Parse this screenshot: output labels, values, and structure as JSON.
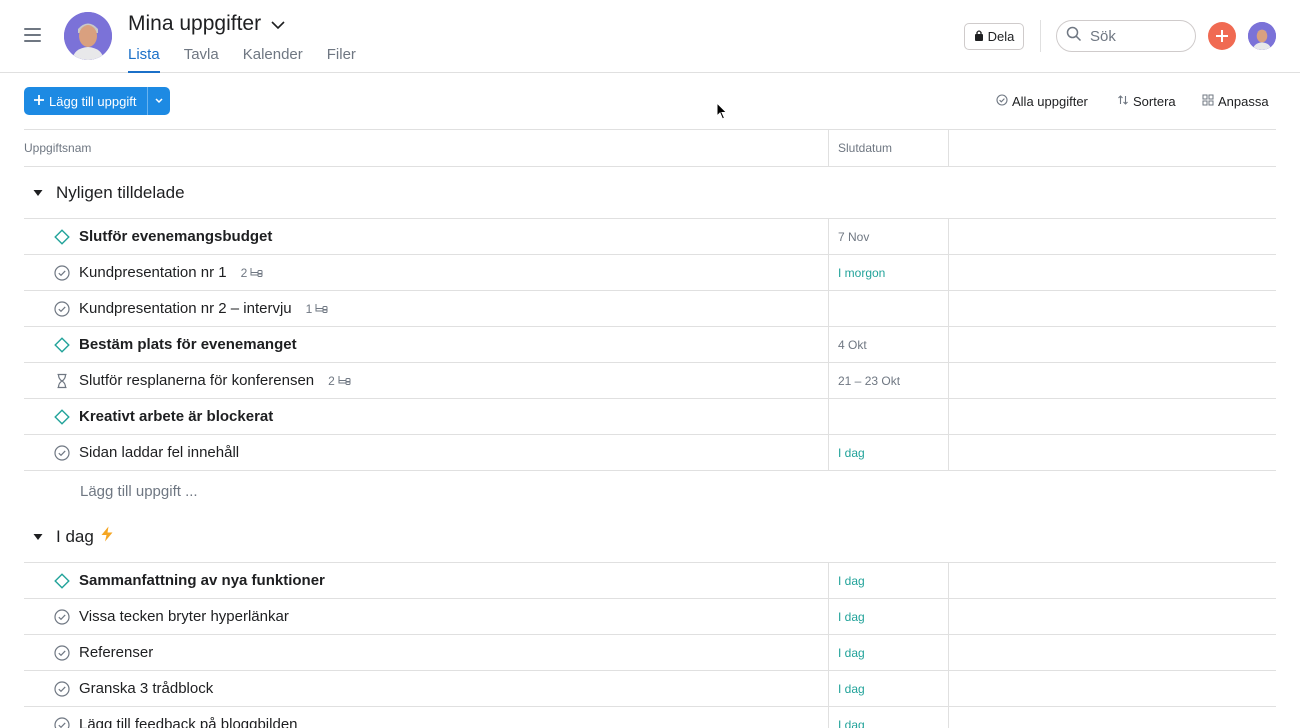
{
  "header": {
    "title": "Mina uppgifter",
    "tabs": [
      {
        "label": "Lista",
        "active": true
      },
      {
        "label": "Tavla",
        "active": false
      },
      {
        "label": "Kalender",
        "active": false
      },
      {
        "label": "Filer",
        "active": false
      }
    ],
    "share_label": "Dela",
    "search_placeholder": "Sök"
  },
  "toolbar": {
    "add_task_label": "Lägg till uppgift",
    "filter_label": "Alla uppgifter",
    "sort_label": "Sortera",
    "customize_label": "Anpassa"
  },
  "table": {
    "col_name": "Uppgiftsnam",
    "col_due": "Slutdatum"
  },
  "sections": [
    {
      "title": "Nyligen tilldelade",
      "emoji": "",
      "tasks": [
        {
          "name": "Slutför evenemangsbudget",
          "bold": true,
          "icon": "milestone-icon",
          "subtasks": "",
          "due": "7 Nov",
          "due_color": "gray"
        },
        {
          "name": "Kundpresentation nr 1",
          "bold": false,
          "icon": "check-circle-icon",
          "subtasks": "2",
          "due": "I morgon",
          "due_color": "green"
        },
        {
          "name": "Kundpresentation nr 2 – intervju",
          "bold": false,
          "icon": "check-circle-icon",
          "subtasks": "1",
          "due": "",
          "due_color": "gray"
        },
        {
          "name": "Bestäm plats för evenemanget",
          "bold": true,
          "icon": "milestone-icon",
          "subtasks": "",
          "due": "4 Okt",
          "due_color": "gray"
        },
        {
          "name": "Slutför resplanerna för konferensen",
          "bold": false,
          "icon": "hourglass-icon",
          "subtasks": "2",
          "due": "21 – 23 Okt",
          "due_color": "gray"
        },
        {
          "name": "Kreativt arbete är blockerat",
          "bold": true,
          "icon": "milestone-icon",
          "subtasks": "",
          "due": "",
          "due_color": "gray"
        },
        {
          "name": "Sidan laddar fel innehåll",
          "bold": false,
          "icon": "check-circle-icon",
          "subtasks": "",
          "due": "I dag",
          "due_color": "green"
        }
      ],
      "add_task_placeholder": "Lägg till uppgift ..."
    },
    {
      "title": "I dag",
      "emoji": "lightning-icon",
      "tasks": [
        {
          "name": "Sammanfattning av nya funktioner",
          "bold": true,
          "icon": "milestone-icon",
          "subtasks": "",
          "due": "I dag",
          "due_color": "green"
        },
        {
          "name": "Vissa tecken bryter hyperlänkar",
          "bold": false,
          "icon": "check-circle-icon",
          "subtasks": "",
          "due": "I dag",
          "due_color": "green"
        },
        {
          "name": "Referenser",
          "bold": false,
          "icon": "check-circle-icon",
          "subtasks": "",
          "due": "I dag",
          "due_color": "green"
        },
        {
          "name": "Granska 3 trådblock",
          "bold": false,
          "icon": "check-circle-icon",
          "subtasks": "",
          "due": "I dag",
          "due_color": "green"
        },
        {
          "name": "Lägg till feedback på bloggbilden",
          "bold": false,
          "icon": "check-circle-icon",
          "subtasks": "",
          "due": "I dag",
          "due_color": "green"
        }
      ],
      "add_task_placeholder": ""
    }
  ],
  "colors": {
    "accent": "#1d8ae3",
    "tab_active": "#1b70c8",
    "due_today": "#22a39a",
    "milestone": "#22a39a",
    "plus_button": "#f06a52",
    "lightning": "#f5a623"
  }
}
